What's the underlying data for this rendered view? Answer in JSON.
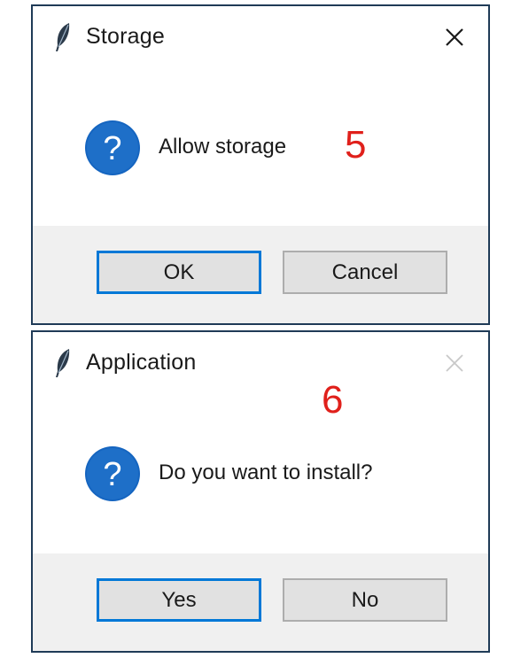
{
  "dialogs": [
    {
      "title": "Storage",
      "message": "Allow storage",
      "number": "5",
      "buttons": {
        "primary": "OK",
        "secondary": "Cancel"
      },
      "close_enabled": true
    },
    {
      "title": "Application",
      "message": "Do you want to install?",
      "number": "6",
      "buttons": {
        "primary": "Yes",
        "secondary": "No"
      },
      "close_enabled": false
    }
  ],
  "icons": {
    "app": "feather-icon",
    "close": "close-icon",
    "message": "question-icon"
  },
  "colors": {
    "accent": "#0078d7",
    "icon_blue": "#1565c0",
    "badge_red": "#e0201b",
    "footer_bg": "#f0f0f0",
    "button_bg": "#e1e1e1",
    "close_enabled": "#1a1a1a",
    "close_disabled": "#c8c8c8"
  }
}
